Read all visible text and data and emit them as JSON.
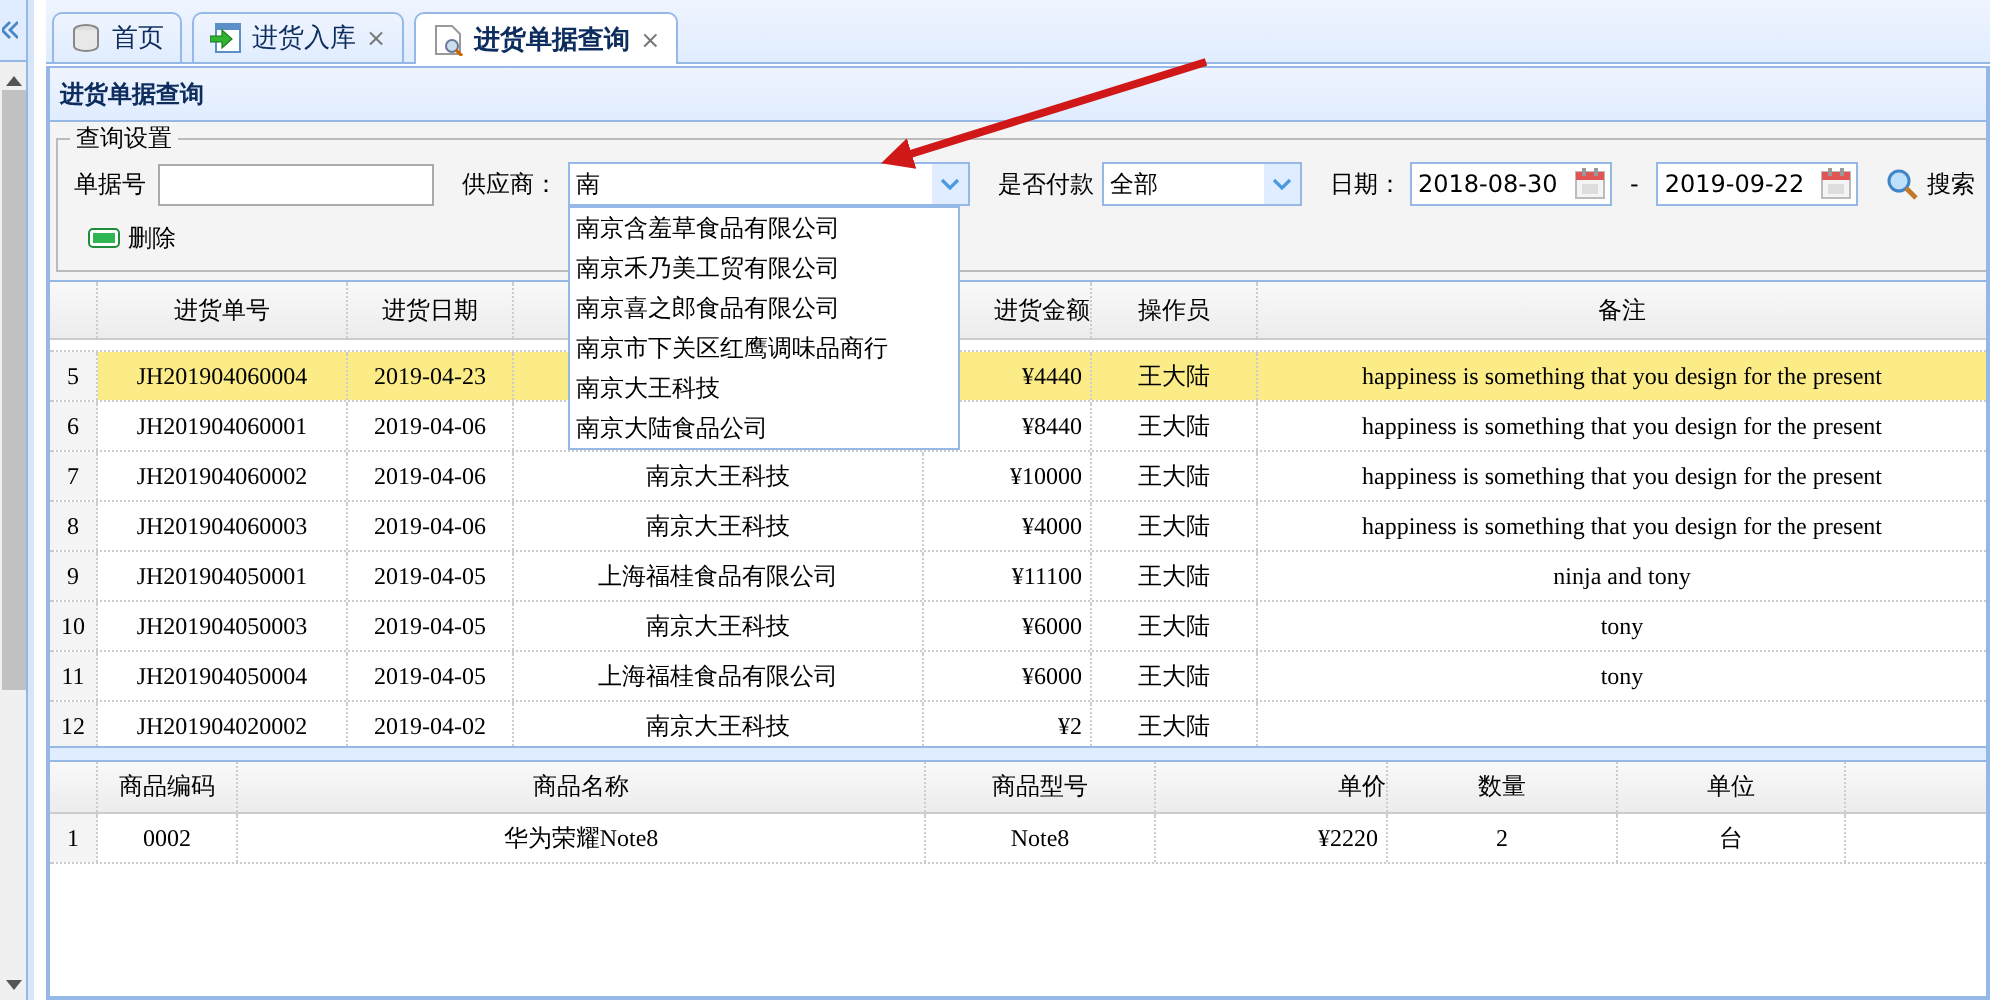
{
  "tabs": [
    {
      "label": "首页",
      "kind": "database",
      "selected": false
    },
    {
      "label": "进货入库",
      "kind": "import",
      "close": "×",
      "selected": false
    },
    {
      "label": "进货单据查询",
      "kind": "document",
      "close": "×",
      "selected": true
    }
  ],
  "panel": {
    "title": "进货单据查询"
  },
  "query": {
    "legend": "查询设置",
    "order_no": {
      "label": "单据号"
    },
    "supplier": {
      "label": "供应商：",
      "value": "南",
      "expanded": true,
      "options": [
        "南京含羞草食品有限公司",
        "南京禾乃美工贸有限公司",
        "南京喜之郎食品有限公司",
        "南京市下关区红鹰调味品商行",
        "南京大王科技",
        "南京大陆食品公司"
      ]
    },
    "paid": {
      "label": "是否付款",
      "value": "全部"
    },
    "date": {
      "label": "日期：",
      "from": "2018-08-30",
      "separator": "-",
      "to": "2019-09-22"
    },
    "search_button": "搜索",
    "delete_button": "删除"
  },
  "orders": {
    "columns": [
      {
        "label": "进货单号"
      },
      {
        "label": "进货日期"
      },
      {},
      {
        "label": "进货金额"
      },
      {
        "label": "操作员"
      },
      {
        "label": "备注"
      }
    ],
    "rows": [
      {
        "no": "5",
        "order": "JH201904060004",
        "date": "2019-04-23",
        "amount": "¥4440",
        "operator": "王大陆",
        "note": "happiness is something that you design for the present",
        "selected": true
      },
      {
        "no": "6",
        "order": "JH201904060001",
        "date": "2019-04-06",
        "amount": "¥8440",
        "operator": "王大陆",
        "note": "happiness is something that you design for the present",
        "selected": false
      },
      {
        "no": "7",
        "order": "JH201904060002",
        "date": "2019-04-06",
        "supplier": "南京大王科技",
        "amount": "¥10000",
        "operator": "王大陆",
        "note": "happiness is something that you design for the present",
        "selected": false
      },
      {
        "no": "8",
        "order": "JH201904060003",
        "date": "2019-04-06",
        "supplier": "南京大王科技",
        "amount": "¥4000",
        "operator": "王大陆",
        "note": "happiness is something that you design for the present",
        "selected": false
      },
      {
        "no": "9",
        "order": "JH201904050001",
        "date": "2019-04-05",
        "supplier": "上海福桂食品有限公司",
        "amount": "¥11100",
        "operator": "王大陆",
        "note": "ninja and tony",
        "selected": false
      },
      {
        "no": "10",
        "order": "JH201904050003",
        "date": "2019-04-05",
        "supplier": "南京大王科技",
        "amount": "¥6000",
        "operator": "王大陆",
        "note": "tony",
        "selected": false
      },
      {
        "no": "11",
        "order": "JH201904050004",
        "date": "2019-04-05",
        "supplier": "上海福桂食品有限公司",
        "amount": "¥6000",
        "operator": "王大陆",
        "note": "tony",
        "selected": false
      },
      {
        "no": "12",
        "order": "JH201904020002",
        "date": "2019-04-02",
        "supplier": "南京大王科技",
        "amount": "¥2",
        "operator": "王大陆",
        "selected": false
      }
    ]
  },
  "items": {
    "columns": [
      "商品编码",
      "商品名称",
      "商品型号",
      "单价",
      "数量",
      "单位"
    ],
    "rows": [
      {
        "no": "1",
        "cells": [
          "0002",
          "华为荣耀Note8",
          "Note8",
          "¥2220",
          "2",
          "台"
        ]
      }
    ]
  }
}
